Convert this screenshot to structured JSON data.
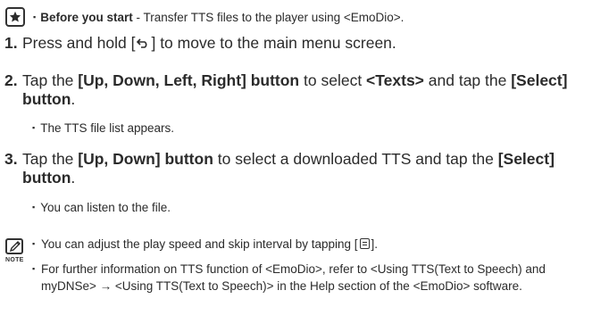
{
  "intro": {
    "bullet": "▪",
    "bold_label": "Before you start",
    "text": " -  Transfer TTS files to the player using <EmoDio>."
  },
  "steps": [
    {
      "number": "1.",
      "parts": [
        "Press and hold [",
        "] to move to the main menu screen."
      ],
      "key_symbol": "back-arrow-icon"
    },
    {
      "number": "2.",
      "parts": [
        "Tap the ",
        "[Up, Down, Left, Right] button",
        " to select ",
        "<Texts>",
        " and tap the ",
        "[Select] button",
        "."
      ],
      "sub_bullet": "The TTS file list appears."
    },
    {
      "number": "3.",
      "parts": [
        "Tap the ",
        "[Up, Down] button",
        " to select a downloaded TTS and tap the ",
        "[Select] button",
        "."
      ],
      "sub_bullet": "You can listen to the file."
    }
  ],
  "note": {
    "label": "NOTE",
    "items": [
      {
        "before_key": "You can adjust the play speed and skip interval by tapping [",
        "after_key": "].",
        "key_symbol": "menu-icon"
      },
      {
        "text": "For further information on TTS function of <EmoDio>, refer to <Using TTS(Text to Speech) and myDNSe> → <Using TTS(Text to Speech)> in the Help section of the <EmoDio> software."
      }
    ]
  },
  "bullet_glyph": "▪"
}
